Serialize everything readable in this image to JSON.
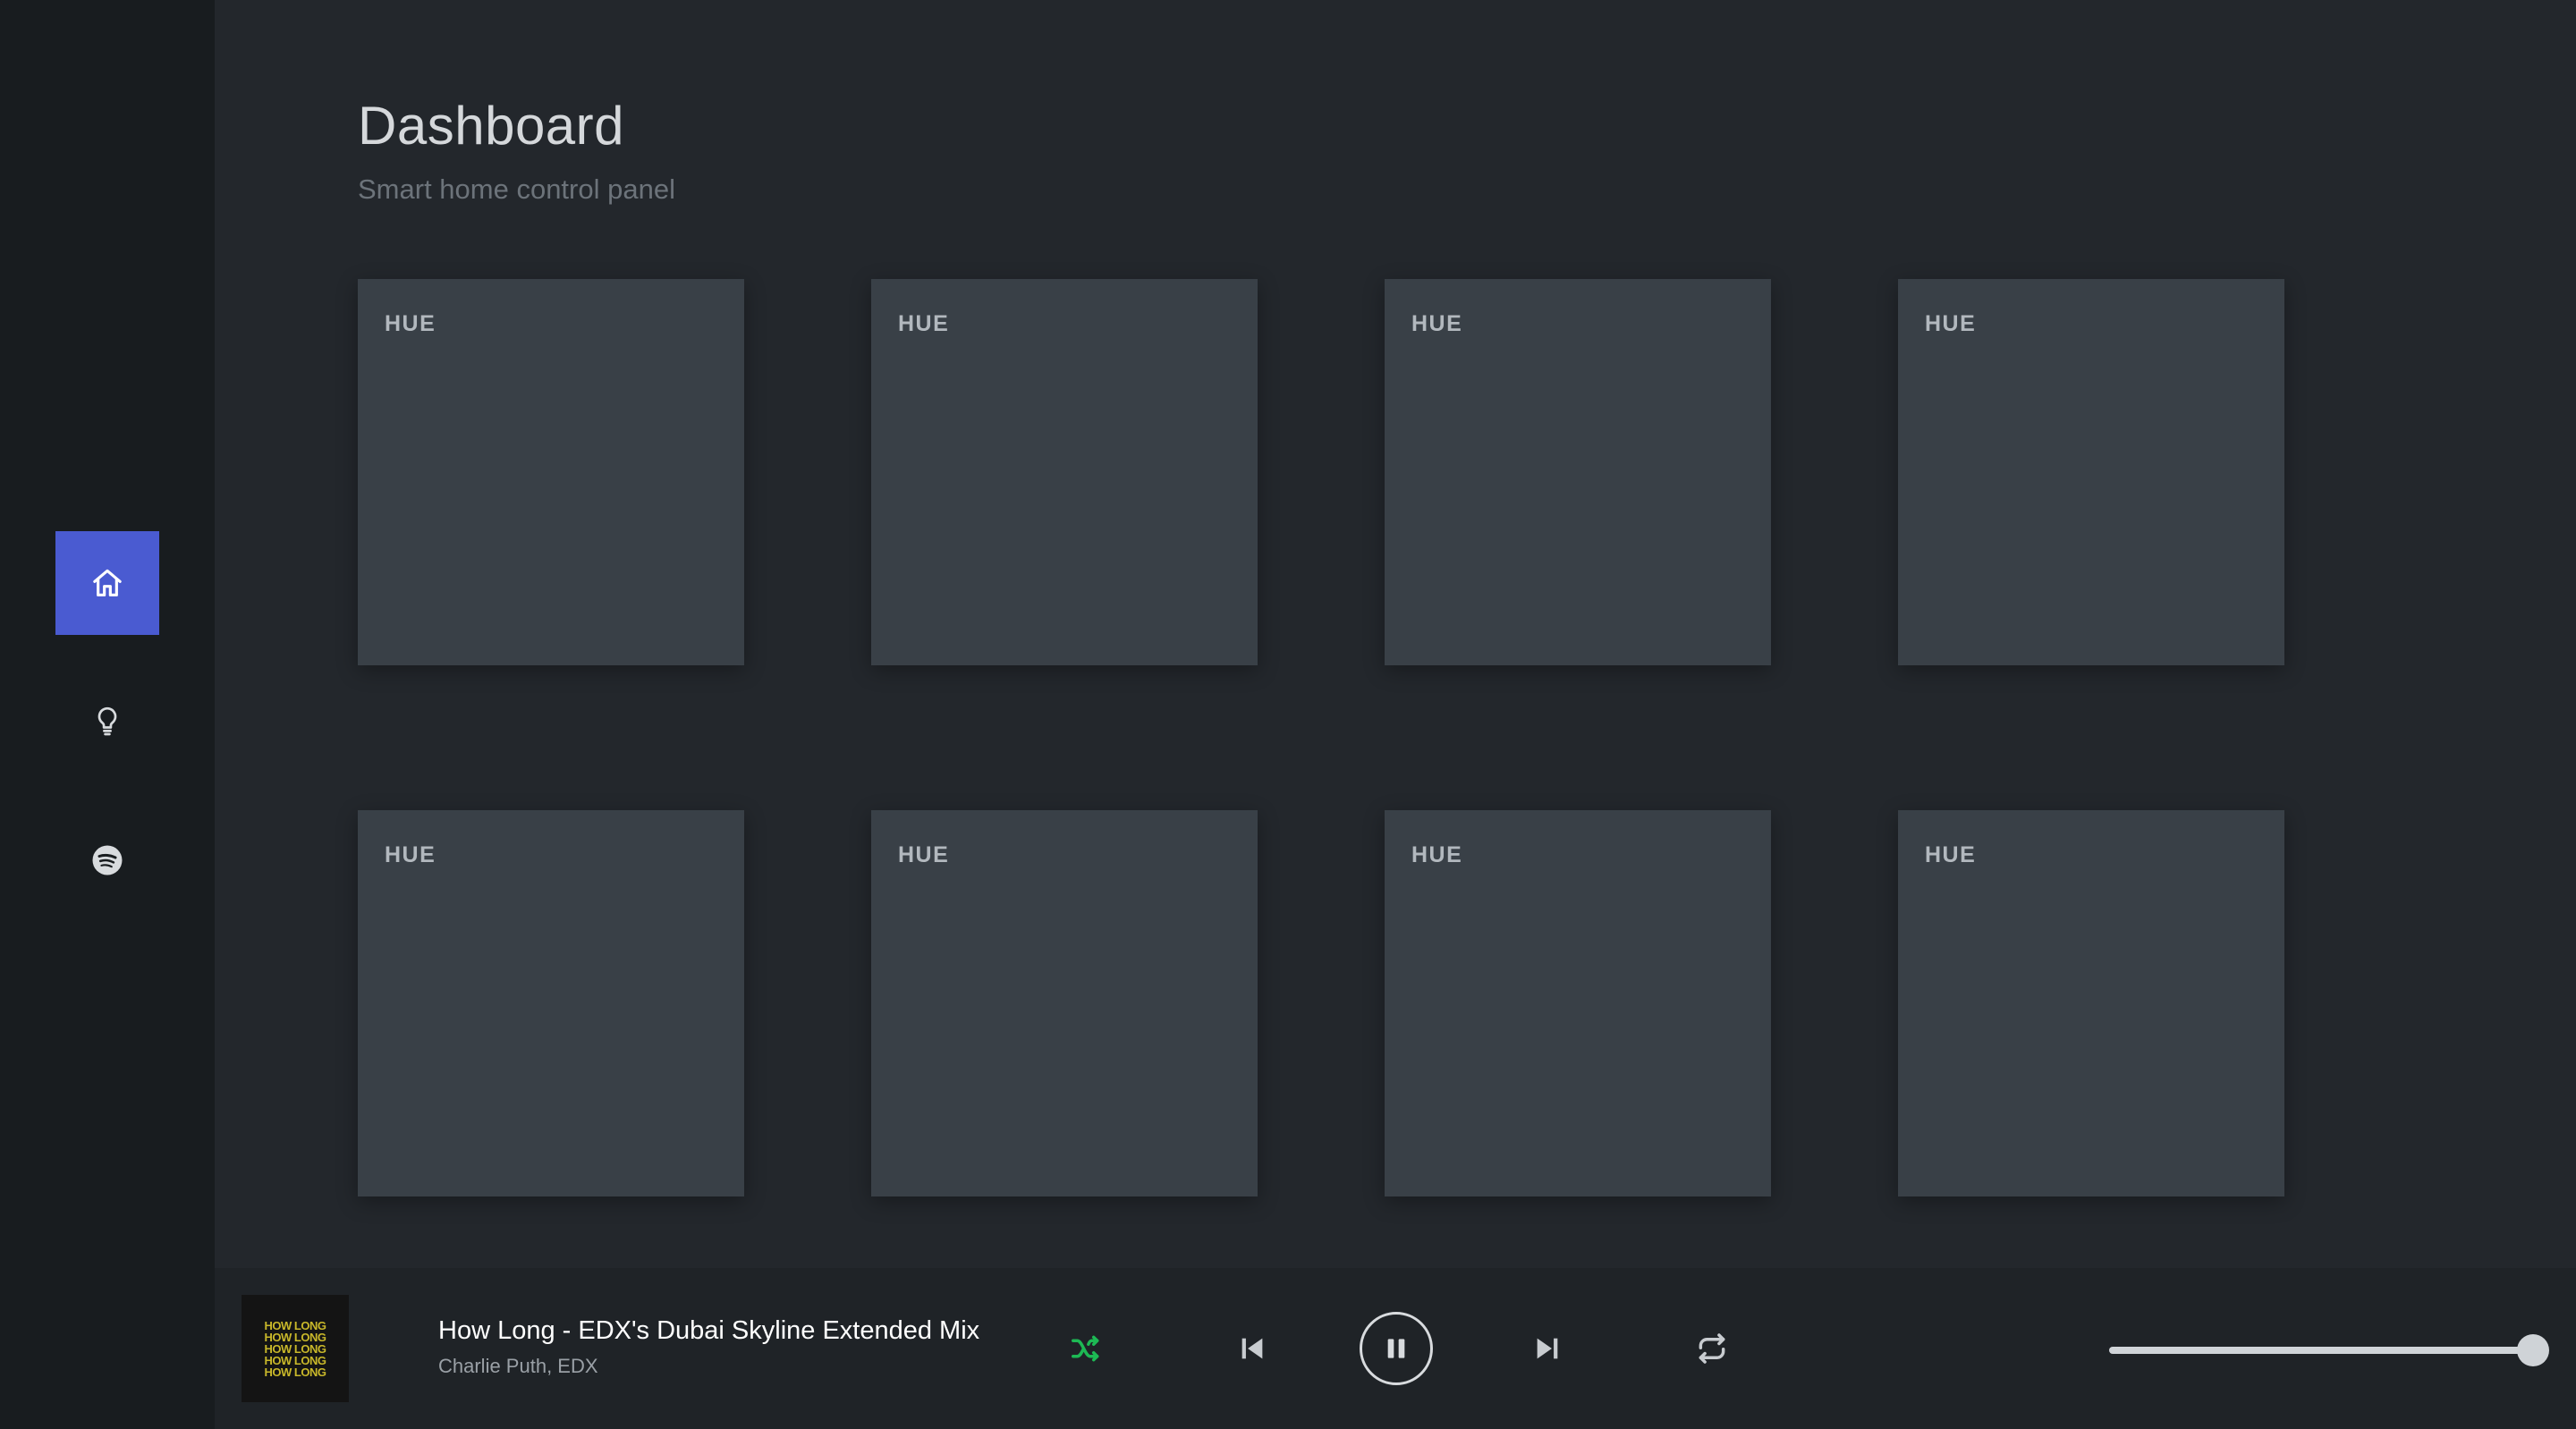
{
  "sidebar": {
    "items": [
      {
        "icon": "home-icon",
        "active": true
      },
      {
        "icon": "lightbulb-icon",
        "active": false
      },
      {
        "icon": "spotify-icon",
        "active": false
      }
    ],
    "accent": "#4a5bd1"
  },
  "header": {
    "title": "Dashboard",
    "subtitle": "Smart home control panel"
  },
  "tiles": [
    {
      "label": "HUE"
    },
    {
      "label": "HUE"
    },
    {
      "label": "HUE"
    },
    {
      "label": "HUE"
    },
    {
      "label": "HUE"
    },
    {
      "label": "HUE"
    },
    {
      "label": "HUE"
    },
    {
      "label": "HUE"
    }
  ],
  "player": {
    "track_title": "How Long - EDX's Dubai Skyline Extended Mix",
    "track_artist": "Charlie Puth, EDX",
    "album_art_text": "HOW LONG",
    "shuffle_on": true,
    "shuffle_color": "#1db954",
    "is_playing": true,
    "volume": 1.0,
    "icons": [
      "shuffle-icon",
      "previous-icon",
      "pause-icon",
      "next-icon",
      "repeat-icon"
    ]
  }
}
